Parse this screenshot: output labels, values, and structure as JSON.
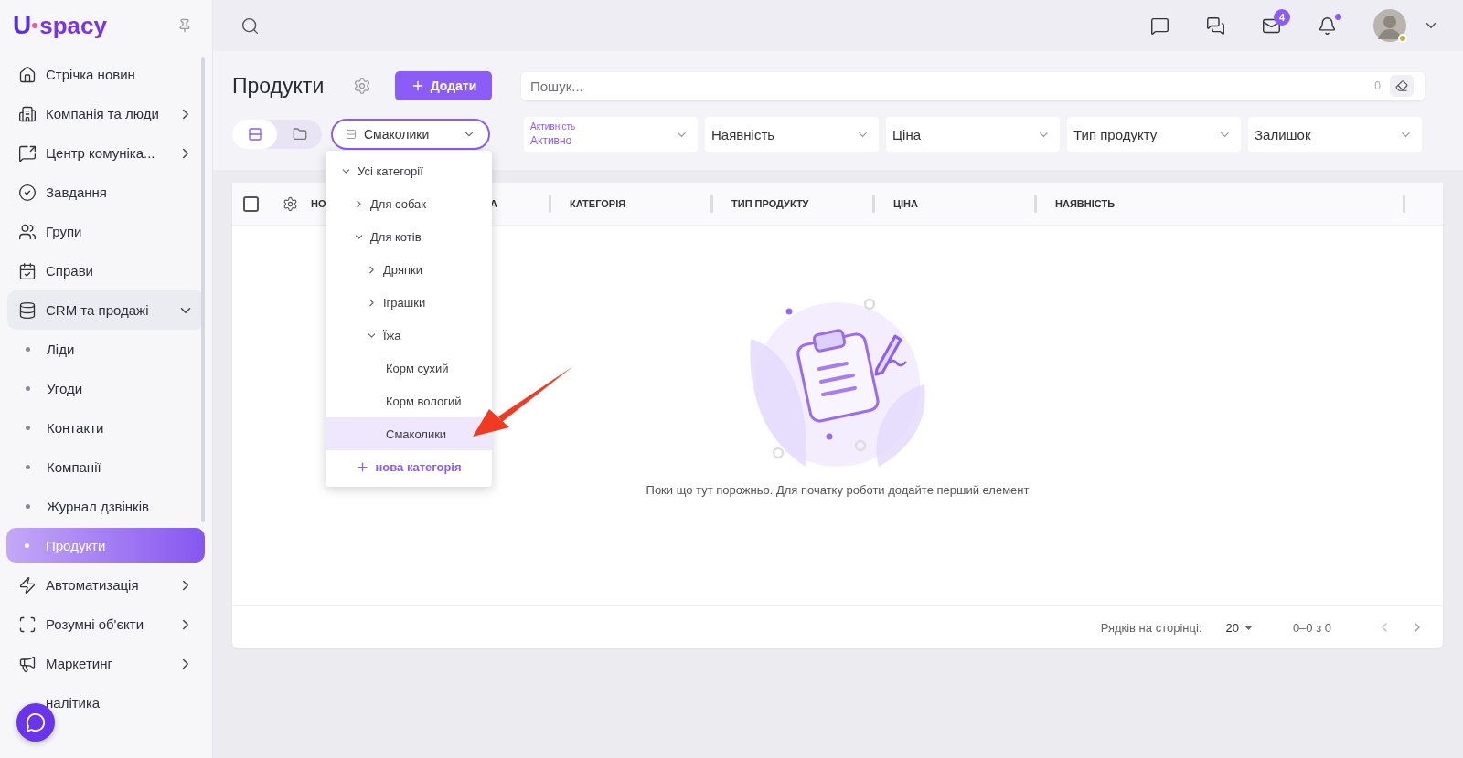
{
  "sidebar": {
    "logo": {
      "mark": "U",
      "name": "spacy"
    },
    "items": [
      {
        "label": "Стрічка новин",
        "selected": false
      },
      {
        "label": "Компанія та люди",
        "selected": false,
        "expanded": false
      },
      {
        "label": "Центр комуніка...",
        "selected": false,
        "expanded": false
      },
      {
        "label": "Завдання",
        "selected": false
      },
      {
        "label": "Групи",
        "selected": false
      },
      {
        "label": "Справи",
        "selected": false
      },
      {
        "label": "CRM та продажі",
        "selected": false,
        "expanded": true,
        "children": [
          {
            "label": "Ліди",
            "selected": false
          },
          {
            "label": "Угоди",
            "selected": false
          },
          {
            "label": "Контакти",
            "selected": false
          },
          {
            "label": "Компанії",
            "selected": false
          },
          {
            "label": "Журнал дзвінків",
            "selected": false
          },
          {
            "label": "Продукти",
            "selected": true
          }
        ]
      },
      {
        "label": "Автоматизація",
        "selected": false,
        "expanded": false
      },
      {
        "label": "Розумні об'єкти",
        "selected": false,
        "expanded": false
      },
      {
        "label": "Маркетинг",
        "selected": false,
        "expanded": false
      },
      {
        "label": "налітика",
        "selected": false
      }
    ]
  },
  "topbar": {
    "mail_badge": "4",
    "notification_dot": true,
    "user": {
      "online": true
    }
  },
  "page": {
    "title": "Продукти",
    "add_button": "Додати"
  },
  "search": {
    "placeholder": "Пошук...",
    "count": "0"
  },
  "view_toggle": [
    {
      "selected": true
    },
    {
      "selected": false
    }
  ],
  "category_select": {
    "value": "Смаколики",
    "open": true
  },
  "filters": [
    {
      "label": "Активність",
      "value": "Активно"
    },
    {
      "label": "Наявність"
    },
    {
      "label": "Ціна"
    },
    {
      "label": "Тип продукту"
    },
    {
      "label": "Залишок"
    }
  ],
  "category_menu": {
    "tree": [
      {
        "label": "Усі категорії",
        "expanded": true,
        "selected": false,
        "children": [
          {
            "label": "Для собак",
            "expanded": false,
            "selected": false
          },
          {
            "label": "Для котів",
            "expanded": true,
            "selected": false,
            "children": [
              {
                "label": "Дряпки",
                "expanded": false,
                "selected": false
              },
              {
                "label": "Іграшки",
                "expanded": false,
                "selected": false
              },
              {
                "label": "Їжа",
                "expanded": true,
                "selected": false,
                "children": [
                  {
                    "label": "Корм сухий",
                    "selected": false
                  },
                  {
                    "label": "Корм вологий",
                    "selected": false
                  },
                  {
                    "label": "Смаколики",
                    "selected": true
                  }
                ]
              }
            ]
          }
        ]
      }
    ],
    "add_label": "нова категорія"
  },
  "table": {
    "select_all": {
      "checked": false
    },
    "columns": [
      "НО",
      "А",
      "КАТЕГОРІЯ",
      "ТИП ПРОДУКТУ",
      "ЦІНА",
      "НАЯВНІСТЬ"
    ],
    "empty_message": "Поки що тут порожньо. Для початку роботи додайте перший елемент",
    "footer": {
      "rows_per_page_label": "Рядків на сторінці:",
      "rows_per_page": "20",
      "range": "0–0 з 0"
    }
  }
}
